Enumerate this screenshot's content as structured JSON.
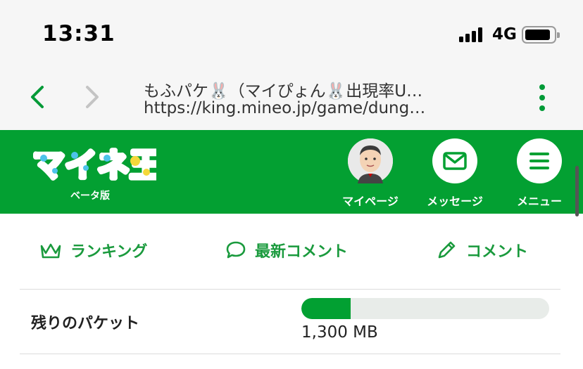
{
  "status_bar": {
    "time": "13:31",
    "network": "4G",
    "battery_level": 0.82
  },
  "browser": {
    "page_title": "もふパケ🐰（マイぴょん🐰出現率U…",
    "url": "https://king.mineo.jp/game/dung…"
  },
  "header": {
    "logo_text": "マイネ王",
    "logo_subtitle": "ベータ版",
    "buttons": [
      {
        "label": "マイページ",
        "icon": "avatar-icon"
      },
      {
        "label": "メッセージ",
        "icon": "envelope-icon"
      },
      {
        "label": "メニュー",
        "icon": "hamburger-icon"
      }
    ]
  },
  "tabs": [
    {
      "label": "ランキング",
      "icon": "crown-icon"
    },
    {
      "label": "最新コメント",
      "icon": "speech-bubble-icon"
    },
    {
      "label": "コメント",
      "icon": "pencil-icon"
    }
  ],
  "packet": {
    "label": "残りのパケット",
    "value": "1,300 MB",
    "fill_fraction": 0.2
  },
  "colors": {
    "brand_green": "#03a032",
    "accent_green": "#1a9a3d",
    "bar_track": "#e8ece9"
  }
}
